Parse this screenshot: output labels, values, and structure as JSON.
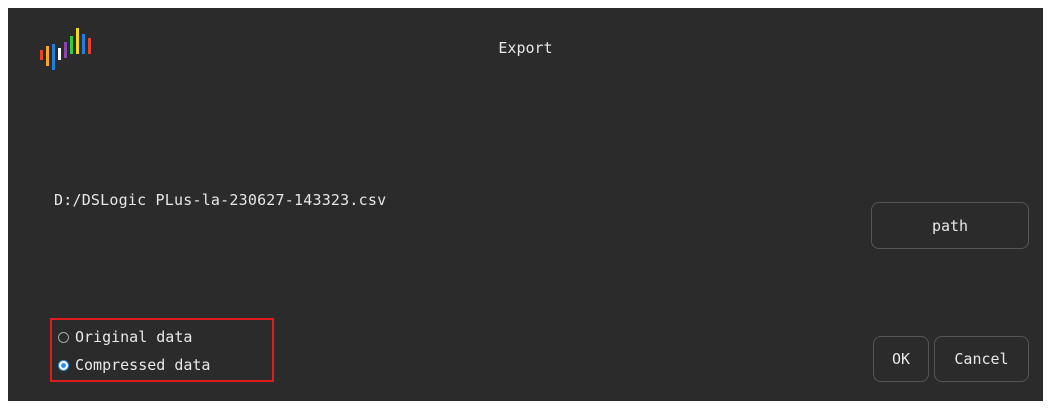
{
  "dialog": {
    "title": "Export",
    "file_path": "D:/DSLogic PLus-la-230627-143323.csv",
    "path_button": "path",
    "ok_button": "OK",
    "cancel_button": "Cancel",
    "options": [
      {
        "label": "Original data",
        "selected": false
      },
      {
        "label": "Compressed data",
        "selected": true
      }
    ],
    "highlight_color": "#e01b1b",
    "accent_color": "#2f8ee8",
    "background_color": "#2b2b2b"
  },
  "logo": {
    "icon": "dslogic-bars-logo",
    "bar_colors": [
      "#e8412c",
      "#f5a623",
      "#f7d51d",
      "#1f7fe0",
      "#ffffff",
      "#8e44ad",
      "#2ecc40",
      "#f7d51d",
      "#1f7fe0",
      "#e8412c"
    ]
  }
}
